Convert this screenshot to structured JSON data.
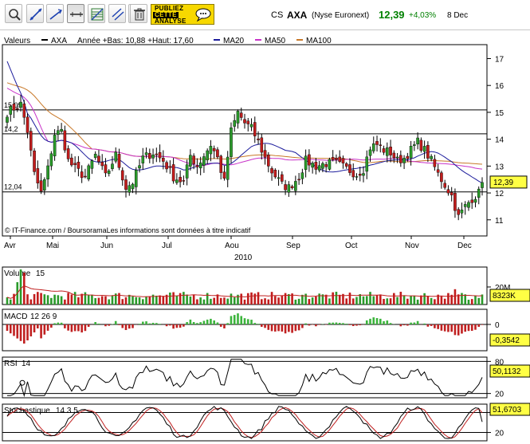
{
  "toolbar": {
    "tools": [
      {
        "name": "zoom-icon",
        "tip": "zoom"
      },
      {
        "name": "line-draw-icon",
        "tip": "line"
      },
      {
        "name": "trend-line-icon",
        "tip": "trend"
      },
      {
        "name": "horizontal-line-icon",
        "tip": "horizontal",
        "active": true
      },
      {
        "name": "fibonacci-icon",
        "tip": "fibonacci"
      },
      {
        "name": "parallel-lines-icon",
        "tip": "parallel"
      },
      {
        "name": "channel-icon",
        "tip": "channel"
      },
      {
        "name": "trash-icon",
        "tip": "delete"
      }
    ],
    "publish": {
      "line1": "PUBLIEZ",
      "line2": "CETTE",
      "line3": "ANALYSE"
    }
  },
  "quote": {
    "type": "CS",
    "name": "AXA",
    "market": "(Nyse Euronext)",
    "price": "12,39",
    "change": "+4,03%",
    "date": "8 Dec"
  },
  "colors": {
    "up": "#2a9a2a",
    "down": "#c21c1c",
    "ma20": "#1c1c9c",
    "ma50": "#c832c8",
    "ma100": "#c87828",
    "macd_hist_pos": "#3cb43c",
    "macd_hist_neg": "#c02020",
    "stoch_k": "#000000",
    "stoch_d": "#c02020",
    "volume_ma": "#c02020"
  },
  "chart_data": [
    {
      "type": "candlestick",
      "panel": "price",
      "legend": {
        "label": "Valeurs",
        "symbol": "AXA",
        "stats": "Année +Bas: 10,88 +Haut: 17,60",
        "ma20": "MA20",
        "ma50": "MA50",
        "ma100": "MA100"
      },
      "ylim": [
        10.4,
        17.4
      ],
      "yticks": [
        "17",
        "16",
        "15",
        "14",
        "13",
        "12",
        "11"
      ],
      "ytick_values": [
        17,
        16,
        15,
        14,
        13,
        12,
        11
      ],
      "hlines": [
        {
          "value": 15.09,
          "label": "15,09"
        },
        {
          "value": 14.2,
          "label": "14,2"
        },
        {
          "value": 12.04,
          "label": "12,04"
        }
      ],
      "xticks": [
        "Avr",
        "Mai",
        "Jun",
        "Jul",
        "Aou",
        "Sep",
        "Oct",
        "Nov",
        "Dec"
      ],
      "year_label": "2010",
      "copyright": "© IT-Finance.com / BoursoramaLes informations sont données à titre indicatif",
      "last_value_label": "12,39",
      "anchors": [
        {
          "i": 0,
          "v": 15.0
        },
        {
          "i": 4,
          "v": 15.3
        },
        {
          "i": 6,
          "v": 14.3
        },
        {
          "i": 8,
          "v": 12.7
        },
        {
          "i": 10,
          "v": 12.0
        },
        {
          "i": 12,
          "v": 12.9
        },
        {
          "i": 14,
          "v": 14.2
        },
        {
          "i": 16,
          "v": 14.3
        },
        {
          "i": 18,
          "v": 13.2
        },
        {
          "i": 20,
          "v": 12.9
        },
        {
          "i": 23,
          "v": 12.6
        },
        {
          "i": 26,
          "v": 13.4
        },
        {
          "i": 29,
          "v": 12.6
        },
        {
          "i": 32,
          "v": 13.4
        },
        {
          "i": 35,
          "v": 12.2
        },
        {
          "i": 37,
          "v": 12.4
        },
        {
          "i": 40,
          "v": 13.3
        },
        {
          "i": 43,
          "v": 13.5
        },
        {
          "i": 46,
          "v": 13.2
        },
        {
          "i": 49,
          "v": 12.6
        },
        {
          "i": 52,
          "v": 12.4
        },
        {
          "i": 54,
          "v": 13.4
        },
        {
          "i": 56,
          "v": 13.0
        },
        {
          "i": 58,
          "v": 13.4
        },
        {
          "i": 60,
          "v": 13.8
        },
        {
          "i": 62,
          "v": 13.3
        },
        {
          "i": 64,
          "v": 12.4
        },
        {
          "i": 66,
          "v": 14.3
        },
        {
          "i": 68,
          "v": 15.0
        },
        {
          "i": 70,
          "v": 14.6
        },
        {
          "i": 72,
          "v": 14.4
        },
        {
          "i": 74,
          "v": 13.9
        },
        {
          "i": 76,
          "v": 13.3
        },
        {
          "i": 78,
          "v": 12.8
        },
        {
          "i": 81,
          "v": 12.3
        },
        {
          "i": 83,
          "v": 12.2
        },
        {
          "i": 86,
          "v": 12.6
        },
        {
          "i": 88,
          "v": 13.2
        },
        {
          "i": 91,
          "v": 13.0
        },
        {
          "i": 94,
          "v": 13.1
        },
        {
          "i": 97,
          "v": 13.1
        },
        {
          "i": 100,
          "v": 12.9
        },
        {
          "i": 103,
          "v": 12.7
        },
        {
          "i": 105,
          "v": 12.9
        },
        {
          "i": 107,
          "v": 13.7
        },
        {
          "i": 109,
          "v": 13.8
        },
        {
          "i": 111,
          "v": 13.6
        },
        {
          "i": 113,
          "v": 13.5
        },
        {
          "i": 115,
          "v": 13.2
        },
        {
          "i": 117,
          "v": 13.3
        },
        {
          "i": 119,
          "v": 13.6
        },
        {
          "i": 121,
          "v": 13.9
        },
        {
          "i": 123,
          "v": 13.6
        },
        {
          "i": 125,
          "v": 13.2
        },
        {
          "i": 127,
          "v": 12.7
        },
        {
          "i": 129,
          "v": 12.3
        },
        {
          "i": 131,
          "v": 11.9
        },
        {
          "i": 133,
          "v": 11.1
        },
        {
          "i": 135,
          "v": 11.5
        },
        {
          "i": 137,
          "v": 11.8
        },
        {
          "i": 139,
          "v": 12.0
        },
        {
          "i": 140,
          "v": 12.39
        }
      ],
      "bars": 141
    },
    {
      "type": "bar",
      "panel": "volume",
      "label": "Volume",
      "param": "15",
      "yticks": [
        "20M"
      ],
      "last_value_label": "8323K"
    },
    {
      "type": "bar",
      "panel": "macd",
      "label": "MACD",
      "param": "12 26 9",
      "yticks": [
        "0"
      ],
      "last_value_label": "-0,3542"
    },
    {
      "type": "line",
      "panel": "rsi",
      "label": "RSI",
      "param": "14",
      "ylim": [
        12,
        88
      ],
      "yticks": [
        "80",
        "20"
      ],
      "ytick_values": [
        80,
        20
      ],
      "last_value_label": "50,1132"
    },
    {
      "type": "line",
      "panel": "stochastic",
      "label": "Stochastique",
      "param": "14 3 5",
      "ylim": [
        -5,
        105
      ],
      "yticks": [
        "80",
        "20"
      ],
      "ytick_values": [
        80,
        20
      ],
      "last_value_label": "51,6703"
    }
  ]
}
